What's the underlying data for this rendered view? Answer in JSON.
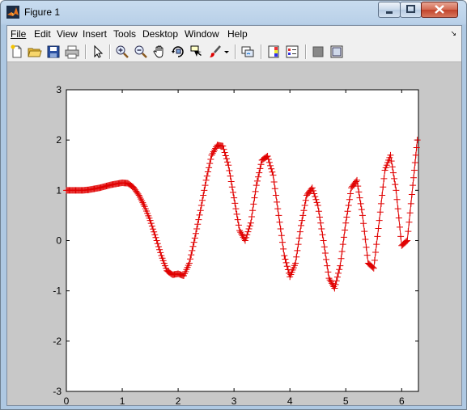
{
  "window": {
    "title": "Figure 1"
  },
  "menu": [
    {
      "label": "File"
    },
    {
      "label": "Edit"
    },
    {
      "label": "View"
    },
    {
      "label": "Insert"
    },
    {
      "label": "Tools"
    },
    {
      "label": "Desktop"
    },
    {
      "label": "Window"
    },
    {
      "label": "Help"
    }
  ],
  "toolbar": [
    "new-figure-icon",
    "open-file-icon",
    "save-icon",
    "print-icon",
    "edit-plot-icon",
    "zoom-in-icon",
    "zoom-out-icon",
    "pan-icon",
    "rotate-3d-icon",
    "data-cursor-icon",
    "brush-icon",
    "link-plot-icon",
    "colorbar-icon",
    "legend-icon",
    "hide-plot-tools-icon",
    "show-plot-tools-icon"
  ],
  "colors": {
    "line": "#e00000",
    "axes_bg": "#ffffff",
    "figure_bg": "#c8c8c8"
  },
  "chart_data": {
    "type": "line",
    "title": "",
    "xlabel": "",
    "ylabel": "",
    "xlim": [
      0,
      6.3
    ],
    "ylim": [
      -3,
      3
    ],
    "xticks": [
      "0",
      "1",
      "2",
      "3",
      "4",
      "5",
      "6"
    ],
    "yticks": [
      "-3",
      "-2",
      "-1",
      "0",
      "1",
      "2",
      "3"
    ],
    "grid": false,
    "marker": "+",
    "series": [
      {
        "x": [
          0,
          0.1,
          0.2,
          0.3,
          0.4,
          0.5,
          0.6,
          0.7,
          0.8,
          0.9,
          1.0,
          1.1,
          1.2,
          1.3,
          1.4,
          1.5,
          1.6,
          1.7,
          1.8,
          1.9,
          2.0,
          2.1,
          2.2,
          2.3,
          2.4,
          2.5,
          2.6,
          2.7,
          2.8,
          2.9,
          3.0,
          3.1,
          3.2,
          3.3,
          3.4,
          3.5,
          3.6,
          3.7,
          3.8,
          3.9,
          4.0,
          4.1,
          4.2,
          4.3,
          4.4,
          4.5,
          4.6,
          4.7,
          4.8,
          4.9,
          5.0,
          5.1,
          5.2,
          5.3,
          5.4,
          5.5,
          5.6,
          5.7,
          5.8,
          5.9,
          6.0,
          6.1,
          6.2,
          6.28
        ],
        "y": [
          1.0,
          1.0,
          1.0,
          1.0,
          1.01,
          1.03,
          1.05,
          1.08,
          1.11,
          1.13,
          1.15,
          1.14,
          1.06,
          0.9,
          0.68,
          0.4,
          0.06,
          -0.3,
          -0.6,
          -0.68,
          -0.66,
          -0.7,
          -0.45,
          0.05,
          0.6,
          1.2,
          1.7,
          1.9,
          1.88,
          1.5,
          0.85,
          0.2,
          0.0,
          0.35,
          1.1,
          1.6,
          1.68,
          1.3,
          0.5,
          -0.3,
          -0.72,
          -0.45,
          0.3,
          0.9,
          1.05,
          0.7,
          0.0,
          -0.75,
          -0.95,
          -0.5,
          0.35,
          1.05,
          1.2,
          0.5,
          -0.45,
          -0.55,
          0.4,
          1.4,
          1.7,
          1.0,
          -0.1,
          0.0,
          1.1,
          2.0
        ]
      }
    ]
  }
}
